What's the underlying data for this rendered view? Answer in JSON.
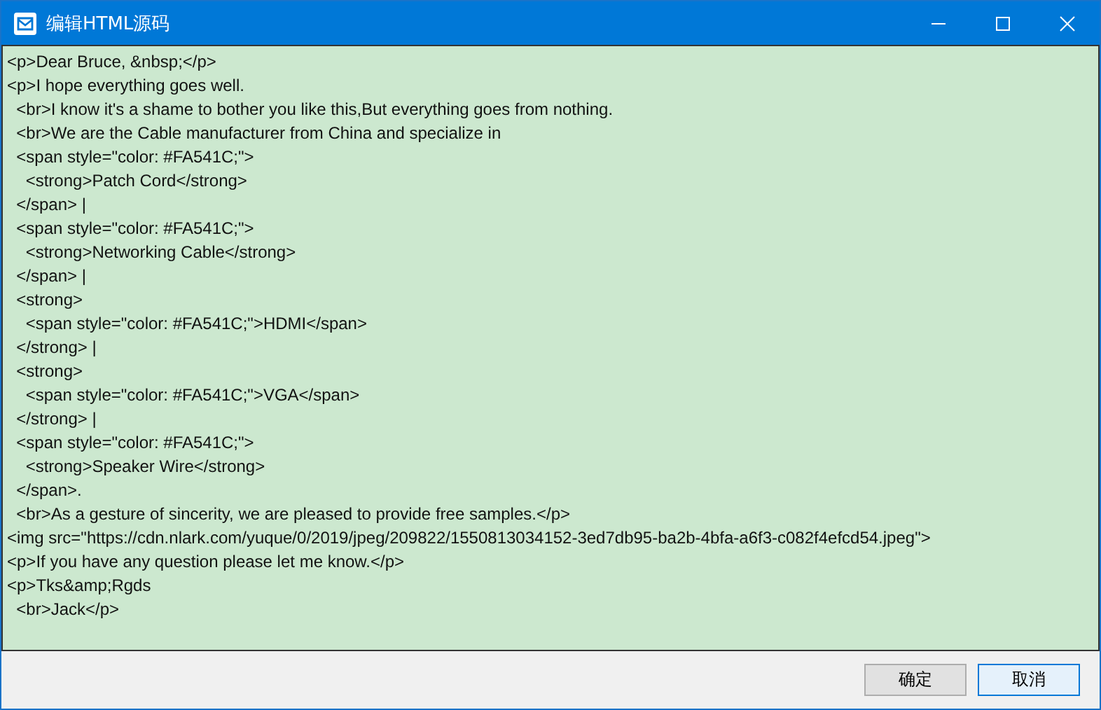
{
  "window": {
    "title": "编辑HTML源码"
  },
  "editor": {
    "lines": [
      "<p>Dear Bruce, &nbsp;</p>",
      "<p>I hope everything goes well.",
      "  <br>I know it's a shame to bother you like this,But everything goes from nothing.",
      "  <br>We are the Cable manufacturer from China and specialize in",
      "  <span style=\"color: #FA541C;\">",
      "    <strong>Patch Cord</strong>",
      "  </span> |",
      "  <span style=\"color: #FA541C;\">",
      "    <strong>Networking Cable</strong>",
      "  </span> |",
      "  <strong>",
      "    <span style=\"color: #FA541C;\">HDMI</span>",
      "  </strong> |",
      "  <strong>",
      "    <span style=\"color: #FA541C;\">VGA</span>",
      "  </strong> |",
      "  <span style=\"color: #FA541C;\">",
      "    <strong>Speaker Wire</strong>",
      "  </span>.",
      "  <br>As a gesture of sincerity, we are pleased to provide free samples.</p>",
      "<img src=\"https://cdn.nlark.com/yuque/0/2019/jpeg/209822/1550813034152-3ed7db95-ba2b-4bfa-a6f3-c082f4efcd54.jpeg\">",
      "<p>If you have any question please let me know.</p>",
      "<p>Tks&amp;Rgds",
      "  <br>Jack</p>"
    ]
  },
  "buttons": [
    {
      "label": "确定",
      "kind": "default"
    },
    {
      "label": "取消",
      "kind": "focused"
    }
  ]
}
